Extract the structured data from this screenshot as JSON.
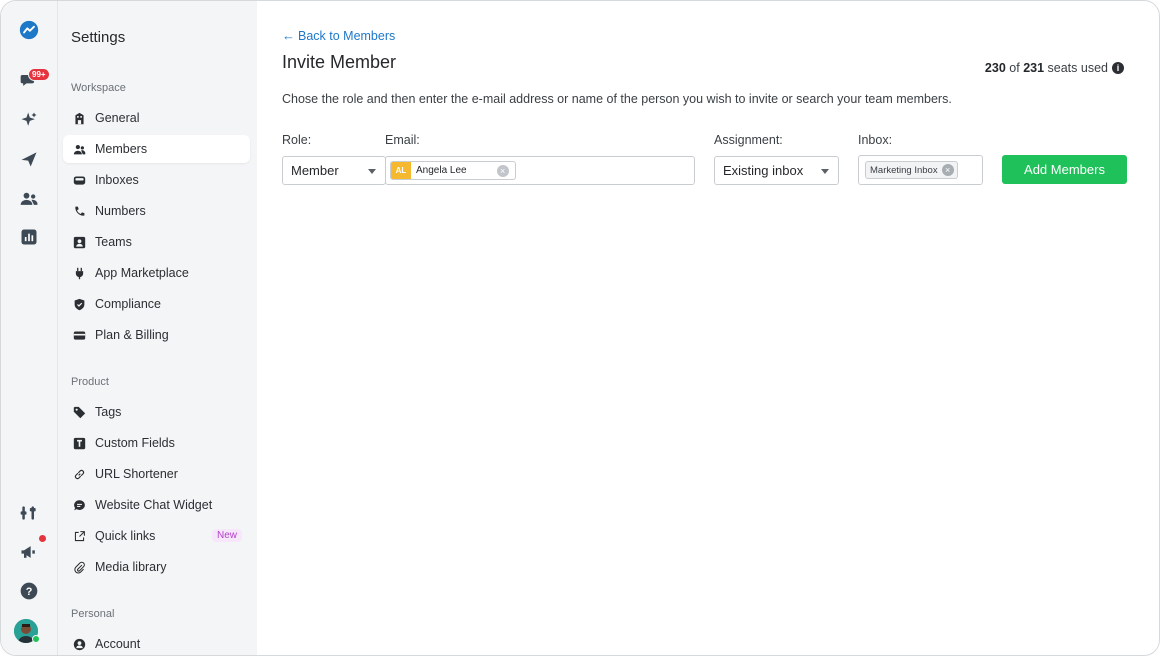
{
  "rail": {
    "notification_badge": "99+",
    "icons": [
      "brand-logo-icon",
      "conversations-icon",
      "sparkle-icon",
      "campaign-send-icon",
      "contacts-icon",
      "reports-icon",
      "integrations-icon",
      "announcements-icon",
      "help-icon"
    ]
  },
  "sidebar": {
    "title": "Settings",
    "workspace_label": "Workspace",
    "workspace_items": [
      {
        "label": "General",
        "icon": "building-icon"
      },
      {
        "label": "Members",
        "icon": "members-icon"
      },
      {
        "label": "Inboxes",
        "icon": "inbox-icon"
      },
      {
        "label": "Numbers",
        "icon": "phone-icon"
      },
      {
        "label": "Teams",
        "icon": "teams-icon"
      },
      {
        "label": "App Marketplace",
        "icon": "plug-icon"
      },
      {
        "label": "Compliance",
        "icon": "shield-icon"
      },
      {
        "label": "Plan & Billing",
        "icon": "credit-card-icon"
      }
    ],
    "product_label": "Product",
    "product_items": [
      {
        "label": "Tags",
        "icon": "tag-icon"
      },
      {
        "label": "Custom Fields",
        "icon": "text-field-icon"
      },
      {
        "label": "URL Shortener",
        "icon": "link-icon"
      },
      {
        "label": "Website Chat Widget",
        "icon": "chat-bubble-icon"
      },
      {
        "label": "Quick links",
        "icon": "external-link-icon",
        "tag": "New"
      },
      {
        "label": "Media library",
        "icon": "paperclip-icon"
      }
    ],
    "personal_label": "Personal",
    "personal_items": [
      {
        "label": "Account",
        "icon": "account-icon"
      }
    ],
    "active_item": "Members"
  },
  "main": {
    "back_link": "Back to Members",
    "title": "Invite Member",
    "seats": {
      "used": "230",
      "of_text": "of",
      "total": "231",
      "suffix": "seats used"
    },
    "description": "Chose the role and then enter the e-mail address or name of the person you wish to invite or search your team members.",
    "form": {
      "role_label": "Role:",
      "role_value": "Member",
      "email_label": "Email:",
      "email_chip": {
        "initials": "AL",
        "name": "Angela Lee"
      },
      "assignment_label": "Assignment:",
      "assignment_value": "Existing inbox",
      "inbox_label": "Inbox:",
      "inbox_chip": "Marketing Inbox",
      "submit_label": "Add Members"
    }
  },
  "colors": {
    "accent_green": "#1fc15a",
    "link_blue": "#1e78c8",
    "badge_red": "#e5343d",
    "chip_initials_bg": "#f5b82e",
    "new_tag_purple": "#b341c9"
  }
}
